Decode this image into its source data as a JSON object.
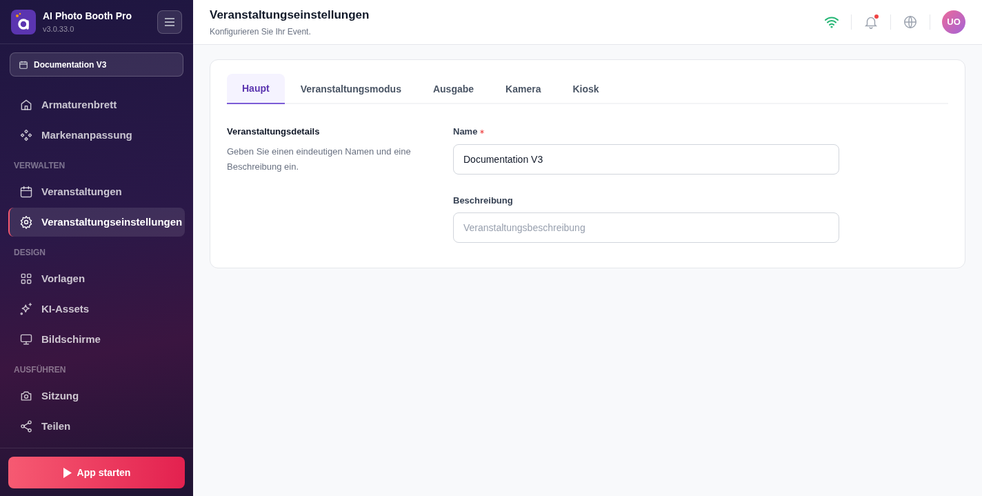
{
  "app": {
    "name": "AI Photo Booth Pro",
    "version": "v3.0.33.0"
  },
  "event_selector": {
    "label": "Documentation V3"
  },
  "sidebar": {
    "sections": [
      {
        "items": [
          {
            "label": "Armaturenbrett",
            "selected": false
          },
          {
            "label": "Markenanpassung",
            "selected": false
          }
        ]
      },
      {
        "heading": "VERWALTEN",
        "items": [
          {
            "label": "Veranstaltungen",
            "selected": false
          },
          {
            "label": "Veranstaltungseinstellungen",
            "selected": true
          }
        ]
      },
      {
        "heading": "DESIGN",
        "items": [
          {
            "label": "Vorlagen",
            "selected": false
          },
          {
            "label": "KI-Assets",
            "selected": false
          },
          {
            "label": "Bildschirme",
            "selected": false
          }
        ]
      },
      {
        "heading": "AUSFÜHREN",
        "items": [
          {
            "label": "Sitzung",
            "selected": false
          },
          {
            "label": "Teilen",
            "selected": false
          }
        ]
      }
    ]
  },
  "launch_button": {
    "label": "App starten"
  },
  "header": {
    "title": "Veranstaltungseinstellungen",
    "subtitle": "Konfigurieren Sie Ihr Event.",
    "notification_unread": true,
    "avatar": "UO"
  },
  "tabs": [
    {
      "label": "Haupt",
      "selected": true
    },
    {
      "label": "Veranstaltungsmodus",
      "selected": false
    },
    {
      "label": "Ausgabe",
      "selected": false
    },
    {
      "label": "Kamera",
      "selected": false
    },
    {
      "label": "Kiosk",
      "selected": false
    }
  ],
  "section": {
    "title": "Veranstaltungsdetails",
    "description": "Geben Sie einen eindeutigen Namen und eine Beschreibung ein."
  },
  "fields": [
    {
      "label": "Name",
      "required": true,
      "value": "Documentation V3"
    },
    {
      "label": "Beschreibung",
      "required": false,
      "placeholder": "Veranstaltungsbeschreibung"
    }
  ]
}
